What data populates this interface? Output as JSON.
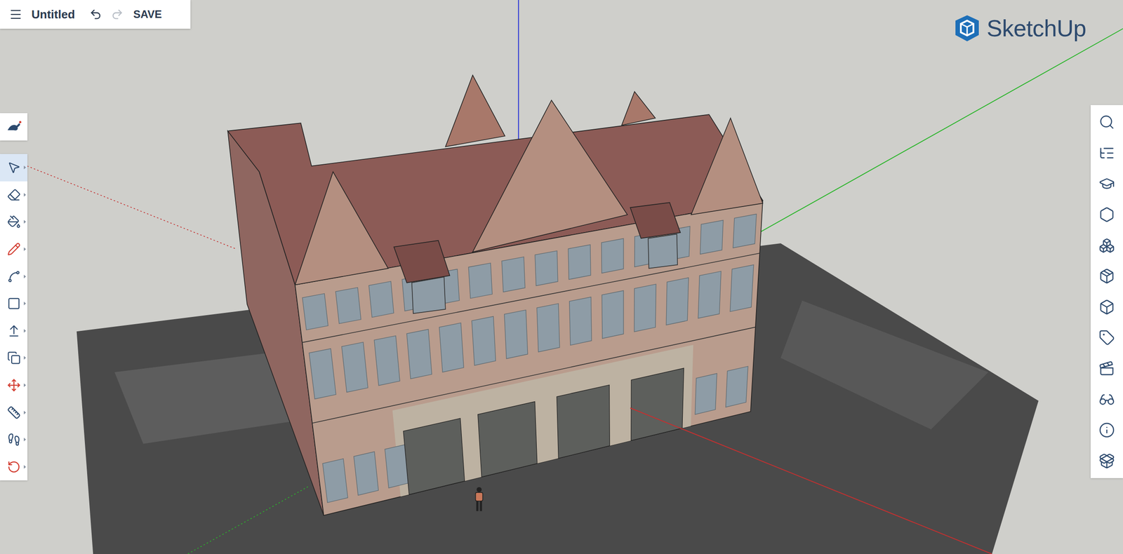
{
  "top_bar": {
    "title": "Untitled",
    "save": "SAVE",
    "undo": {
      "disabled": false
    },
    "redo": {
      "disabled": true
    }
  },
  "logo": {
    "text": "SketchUp"
  },
  "left_toolbar": {
    "top_tool": {
      "selected": false,
      "flyout": false
    },
    "tools": [
      {
        "selected": true,
        "flyout": true
      },
      {
        "selected": false,
        "flyout": true
      },
      {
        "selected": false,
        "flyout": true
      },
      {
        "selected": false,
        "flyout": true
      },
      {
        "selected": false,
        "flyout": true
      },
      {
        "selected": false,
        "flyout": true
      },
      {
        "selected": false,
        "flyout": true
      },
      {
        "selected": false,
        "flyout": true
      },
      {
        "selected": false,
        "flyout": true
      },
      {
        "selected": false,
        "flyout": true
      },
      {
        "selected": false,
        "flyout": true
      },
      {
        "selected": false,
        "flyout": true
      }
    ]
  },
  "right_toolbar": {
    "panels": [
      {
        "selected": false
      },
      {
        "selected": false
      },
      {
        "selected": false
      },
      {
        "selected": false
      },
      {
        "selected": false
      },
      {
        "selected": false
      },
      {
        "selected": false
      },
      {
        "selected": false
      },
      {
        "selected": false
      },
      {
        "selected": false
      },
      {
        "selected": false
      },
      {
        "selected": false
      }
    ]
  }
}
